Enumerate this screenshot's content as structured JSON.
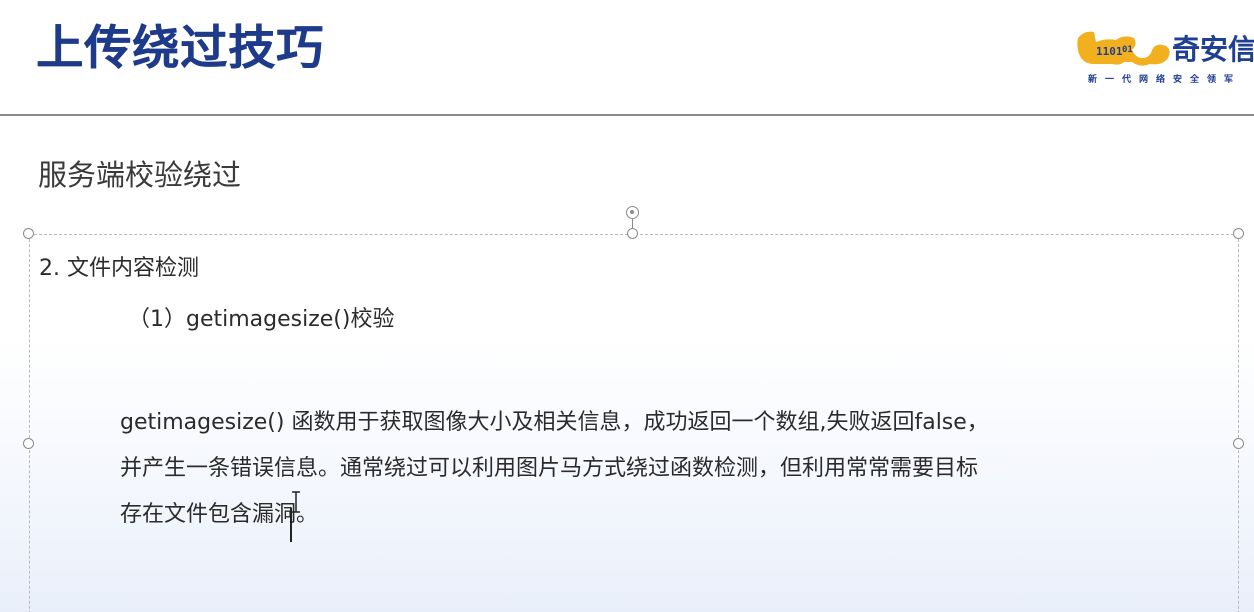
{
  "slide": {
    "title": "上传绕过技巧",
    "logo": {
      "name": "奇安信",
      "tagline": "新一代网络安全领军"
    },
    "section_heading": "服务端校验绕过",
    "content": {
      "item_number": "2. 文件内容检测",
      "subitem": "（1）getimagesize()校验",
      "paragraph_lines": [
        "getimagesize() 函数用于获取图像大小及相关信息，成功返回一个数组,失败返回false，",
        "并产生一条错误信息。通常绕过可以利用图片马方式绕过函数检测，但利用常常需要目标",
        "存在文件包含漏洞。"
      ]
    }
  },
  "colors": {
    "title": "#1e3a8a",
    "logo": "#1f3f93",
    "logo_accent": "#f2b01e",
    "body_text": "#2b2b2b",
    "heading_text": "#3a3a3a",
    "rule": "#8a8a8a",
    "selection_border": "#b9b9b9"
  }
}
